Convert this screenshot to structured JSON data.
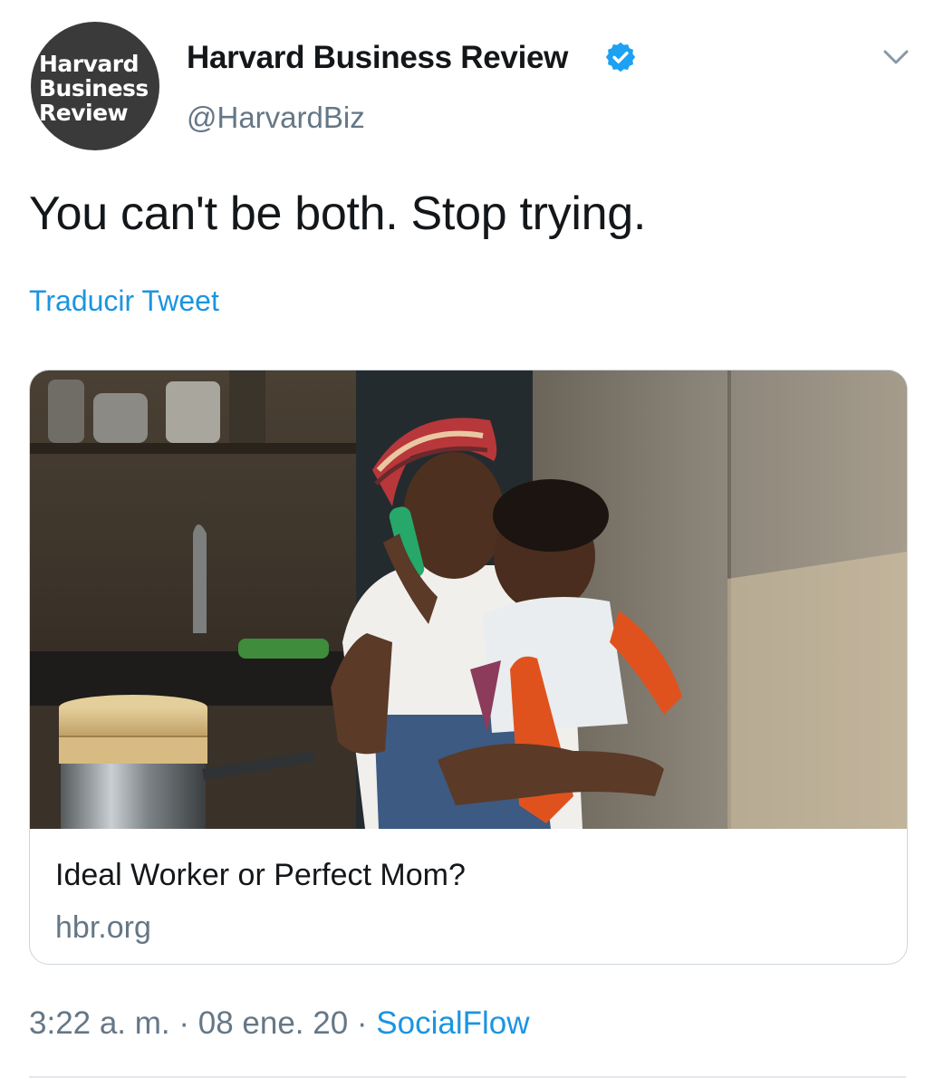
{
  "author": {
    "avatar_lines": [
      "Harvard",
      "Business",
      "Review"
    ],
    "display_name": "Harvard Business Review",
    "handle": "@HarvardBiz",
    "verified": true,
    "verified_color": "#1da1f2"
  },
  "tweet": {
    "text": "You can't be both. Stop trying.",
    "translate_label": "Traducir Tweet"
  },
  "card": {
    "title": "Ideal Worker or Perfect Mom?",
    "domain": "hbr.org",
    "image_icon": "photo-woman-on-phone-holding-baby-in-kitchen"
  },
  "meta": {
    "time": "3:22 a. m.",
    "separator": " · ",
    "date": "08 ene. 20",
    "source": "SocialFlow"
  },
  "colors": {
    "link": "#1b95e0",
    "secondary_text": "#657786",
    "primary_text": "#14171a",
    "border": "#ccd6dd"
  }
}
